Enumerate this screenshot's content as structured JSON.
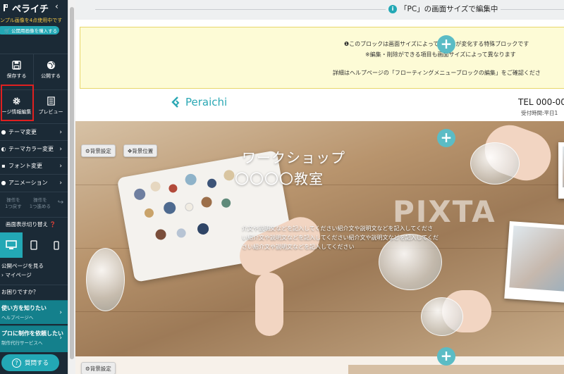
{
  "sidebar": {
    "logo": "ペライチ",
    "collapse_icon": "chevron-left-icon",
    "sample_notice": "ンプル画像を4点使用中です",
    "buy_button": "🛒 公開用画像を購入する",
    "save_label": "保存する",
    "publish_label": "公開する",
    "page_info_label": "ージ情報編集",
    "preview_label": "プレビュー",
    "menu": [
      {
        "label": "テーマ変更",
        "icon": "brush-icon"
      },
      {
        "label": "テーマカラー変更",
        "icon": "palette-icon"
      },
      {
        "label": "フォント変更",
        "icon": "font-icon"
      },
      {
        "label": "アニメーション",
        "icon": "animation-icon"
      }
    ],
    "undo": {
      "line1": "操作を",
      "line2": "1つ戻す"
    },
    "redo": {
      "line1": "操作を",
      "line2": "1つ進める"
    },
    "screen_switch_label": "画面表示切り替え ❓",
    "view_public_page": "公開ページを見る",
    "my_page": "マイページ",
    "help_label": "お困りですか？",
    "howto_title": "使い方を知りたい",
    "howto_sub": "ヘルプページへ",
    "request_title": "プロに制作を依頼したい",
    "request_sub": "制作代行サービスへ",
    "ask_button": "質問する"
  },
  "topbar": {
    "mode_text": "「PC」の画面サイズで編集中"
  },
  "notice": {
    "line1": "このブロックは画面サイズによって見た目が変化する特殊ブロックです",
    "line2": "※編集・削除ができる項目も画面サイズによって異なります",
    "line3": "詳細はヘルプページの「フローティングメニューブロックの編集」をご確認くださ"
  },
  "site_header": {
    "logo_text": "Peraichi",
    "tel": "TEL 000-00",
    "hours": "受付時間:平日1"
  },
  "hero": {
    "title1": "ワークショップ",
    "title2": "〇〇〇〇教室",
    "desc1": "介文や説明文などを記入してください紹介文や説明文などを記入してくださ",
    "desc2": "い紹介文や説明文などを記入してください紹介文や説明文などを記入してくだ",
    "desc3": "さい紹介文や説明文などを記入してください",
    "watermark": "PIXTA",
    "bg_settings": "背景設定",
    "bg_position": "背景位置"
  },
  "lower": {
    "bg_settings": "背景設定"
  },
  "colors": {
    "sidebar_bg": "#1b2a36",
    "accent": "#23a8b5",
    "highlight": "#e02020",
    "notice_bg": "#fdfbd6"
  }
}
